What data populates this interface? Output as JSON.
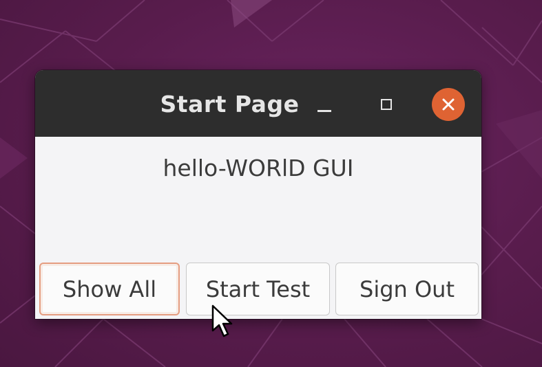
{
  "window": {
    "title": "Start Page"
  },
  "content": {
    "heading": "hello-WORlD GUI"
  },
  "buttons": {
    "show_all": "Show All",
    "start_test": "Start Test",
    "sign_out": "Sign Out"
  },
  "icons": {
    "minimize": "minimize-icon",
    "maximize": "maximize-icon",
    "close": "close-icon",
    "cursor": "mouse-pointer-icon"
  },
  "colors": {
    "desktop_background": "#5a1e4e",
    "titlebar": "#2d2d2d",
    "close_button": "#df6333",
    "window_body": "#f4f4f6",
    "focus_ring": "#e59d80"
  }
}
